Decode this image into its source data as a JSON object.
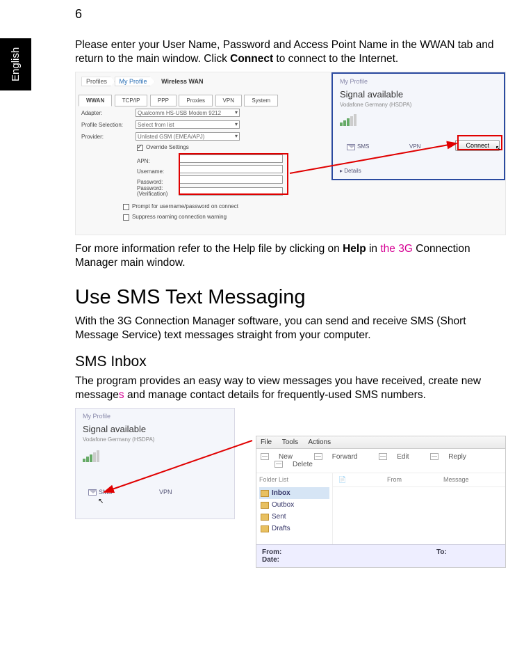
{
  "page_number": "6",
  "language_tab": "English",
  "intro_para_pre": "Please enter your User Name, Password and Access Point Name in the WWAN tab and return to the main window. Click ",
  "intro_bold": "Connect",
  "intro_para_post": " to connect to the Internet.",
  "help_para_pre": "For more information refer to the Help file by clicking on ",
  "help_bold": "Help",
  "help_para_mid": " in ",
  "help_edit": "the 3G",
  "help_para_rest": " Connection Manager main window.",
  "h1": "Use SMS Text Messaging",
  "h1_para": "With the 3G Connection Manager software, you can send and receive SMS (Short Message Service) text messages straight from your computer.",
  "h2": "SMS Inbox",
  "h2_para_pre": "The program provides an easy way to view messages you have received, create new message",
  "h2_edit": "s",
  "h2_para_post": " and manage contact details for frequently-used SMS numbers.",
  "shot1": {
    "crumb1": "Profiles",
    "crumb2": "My Profile",
    "title": "Wireless WAN",
    "tabs": [
      "WWAN",
      "TCP/IP",
      "PPP",
      "Proxies",
      "VPN",
      "System"
    ],
    "adapter_lbl": "Adapter:",
    "adapter_val": "Qualcomm HS-USB Modem 9212",
    "profile_lbl": "Profile Selection:",
    "profile_val": "Select from list",
    "provider_lbl": "Provider:",
    "provider_val": "Unlisted GSM (EMEA/APJ)",
    "override": "Override Settings",
    "apn_lbl": "APN:",
    "user_lbl": "Username:",
    "pass_lbl": "Password:",
    "pass2_lbl1": "Password:",
    "pass2_lbl2": "(Verification)",
    "prompt": "Prompt for username/password on connect",
    "suppress": "Suppress roaming connection warning",
    "side": {
      "profile": "My Profile",
      "signal": "Signal available",
      "carrier": "Vodafone Germany (HSDPA)",
      "sms": "SMS",
      "vpn": "VPN",
      "details": "▸ Details",
      "connect": "Connect"
    }
  },
  "shot2": {
    "profile": "My Profile",
    "signal": "Signal available",
    "carrier": "Vodafone Germany (HSDPA)",
    "sms": "SMS",
    "vpn": "VPN",
    "menu": [
      "File",
      "Tools",
      "Actions"
    ],
    "tb": {
      "new": "New",
      "forward": "Forward",
      "edit": "Edit",
      "reply": "Reply",
      "delete": "Delete"
    },
    "folder_header": "Folder List",
    "folders": [
      "Inbox",
      "Outbox",
      "Sent",
      "Drafts"
    ],
    "col_icon": "",
    "col_from": "From",
    "col_msg": "Message",
    "footer_from": "From:",
    "footer_to": "To:",
    "footer_date": "Date:"
  }
}
